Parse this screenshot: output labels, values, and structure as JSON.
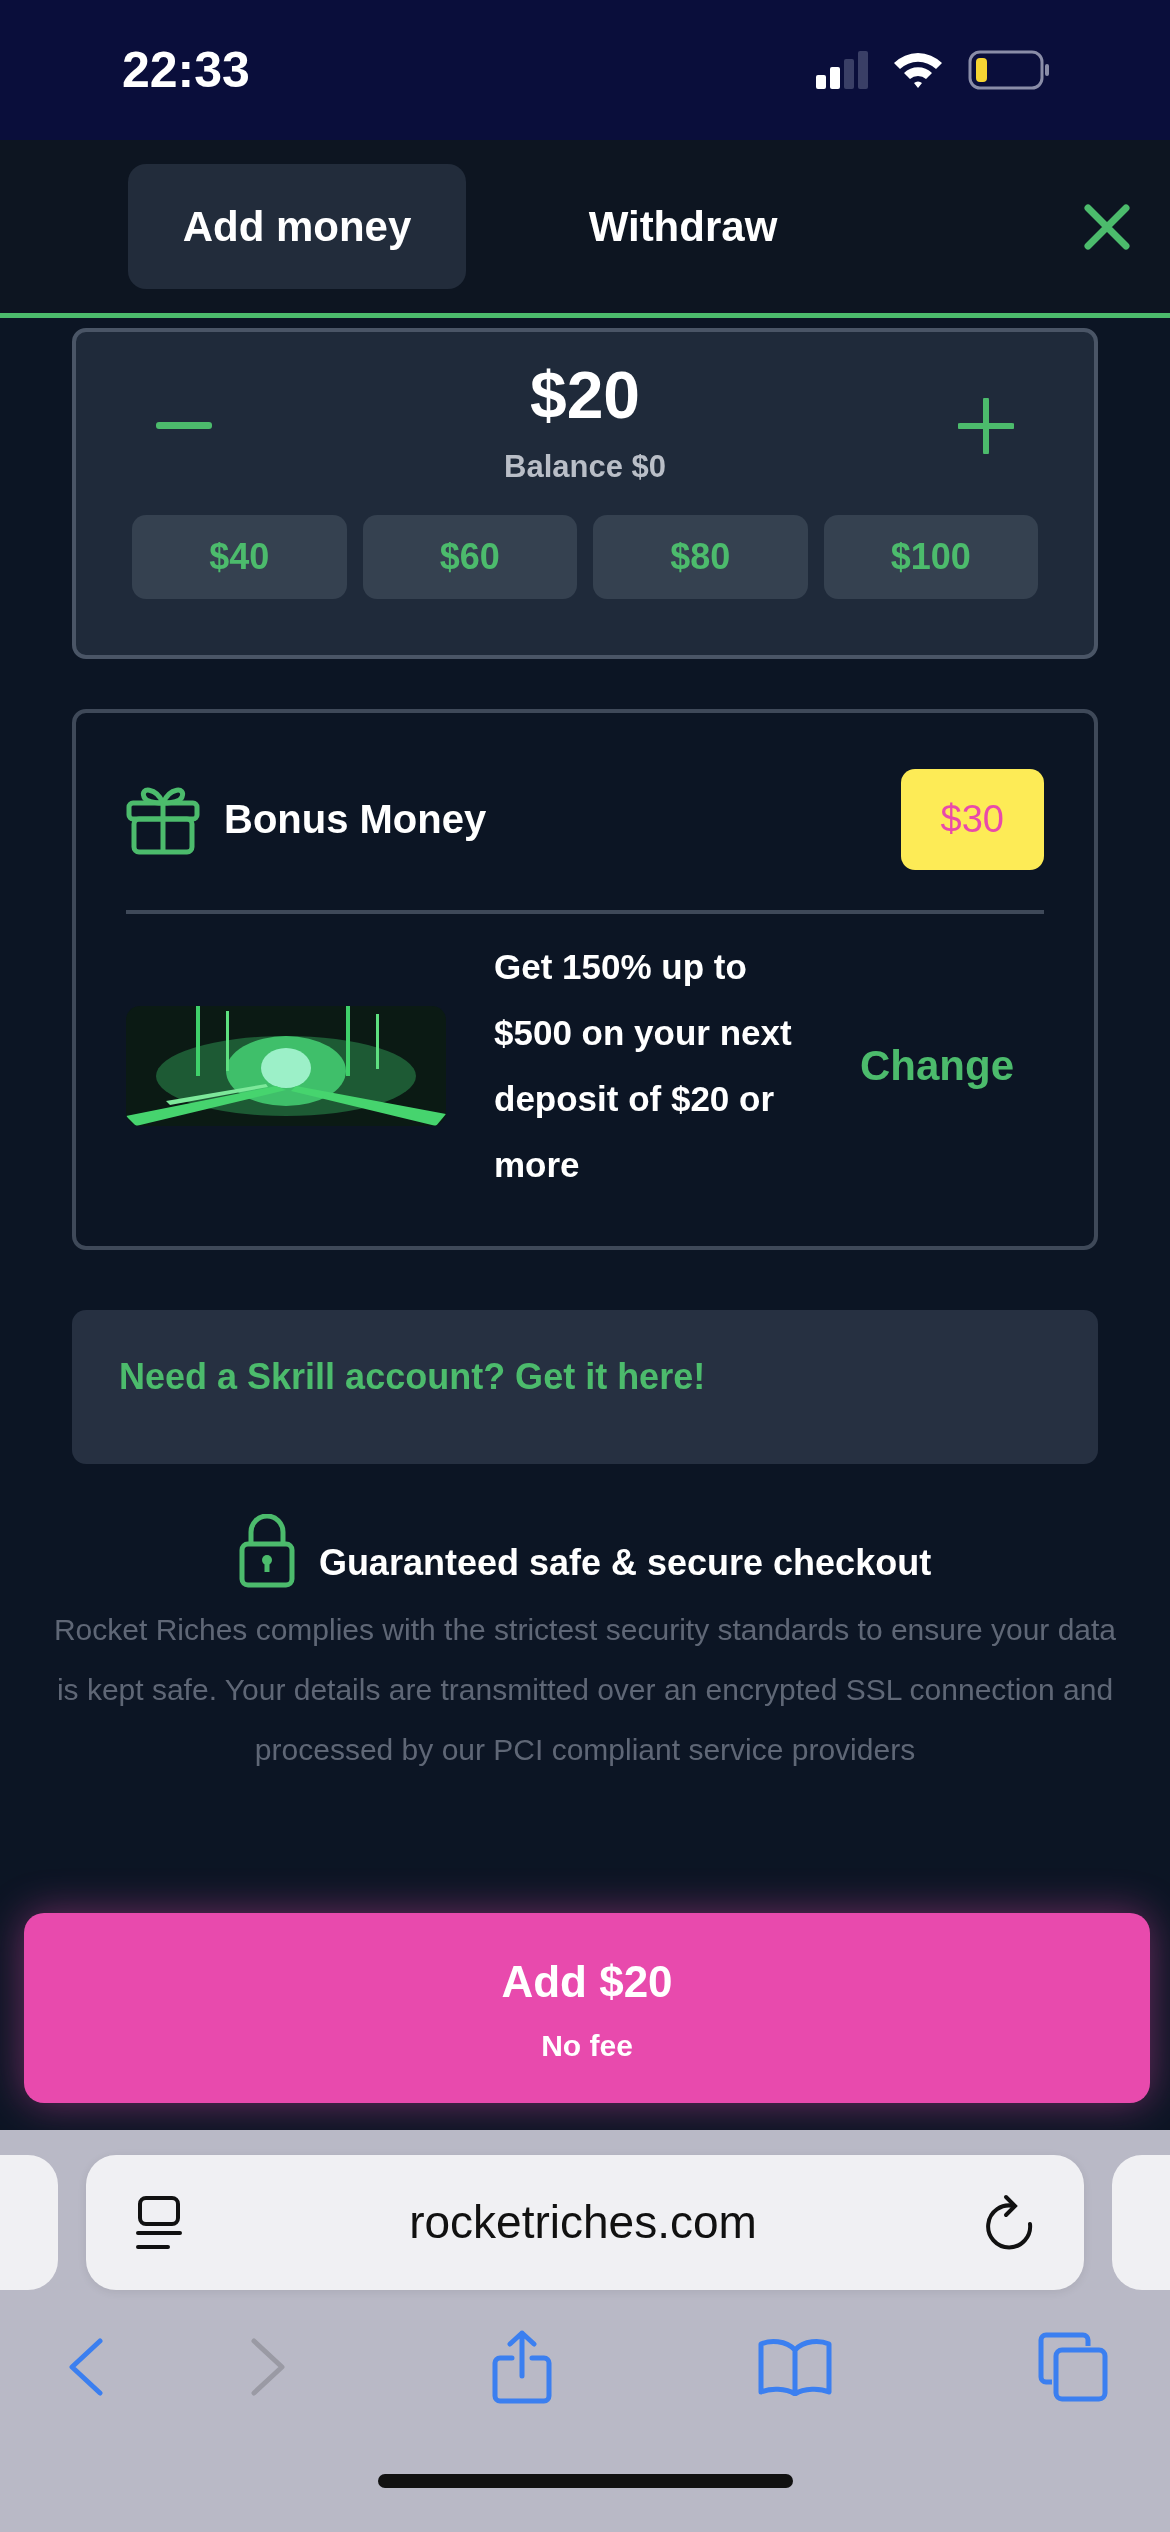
{
  "status_bar": {
    "time": "22:33"
  },
  "tabs": [
    {
      "label": "Add money",
      "selected": true
    },
    {
      "label": "Withdraw",
      "selected": false
    }
  ],
  "amount": {
    "value": "$20",
    "balance": "Balance $0",
    "presets": [
      "$40",
      "$60",
      "$80",
      "$100"
    ]
  },
  "bonus": {
    "title": "Bonus Money",
    "amount": "$30",
    "offer": "Get 150% up to $500 on your next deposit of $20 or more",
    "action": "Change"
  },
  "skrill_link": "Need a Skrill account? Get it here!",
  "security": {
    "title": "Guaranteed safe & secure checkout",
    "text": "Rocket Riches complies with the strictest security standards to ensure your data is kept safe. Your details are transmitted over an encrypted SSL connection and processed by our PCI compliant service providers"
  },
  "submit": {
    "label": "Add $20",
    "note": "No fee"
  },
  "browser": {
    "url": "rocketriches.com",
    "back_disabled": false,
    "forward_disabled": true
  }
}
